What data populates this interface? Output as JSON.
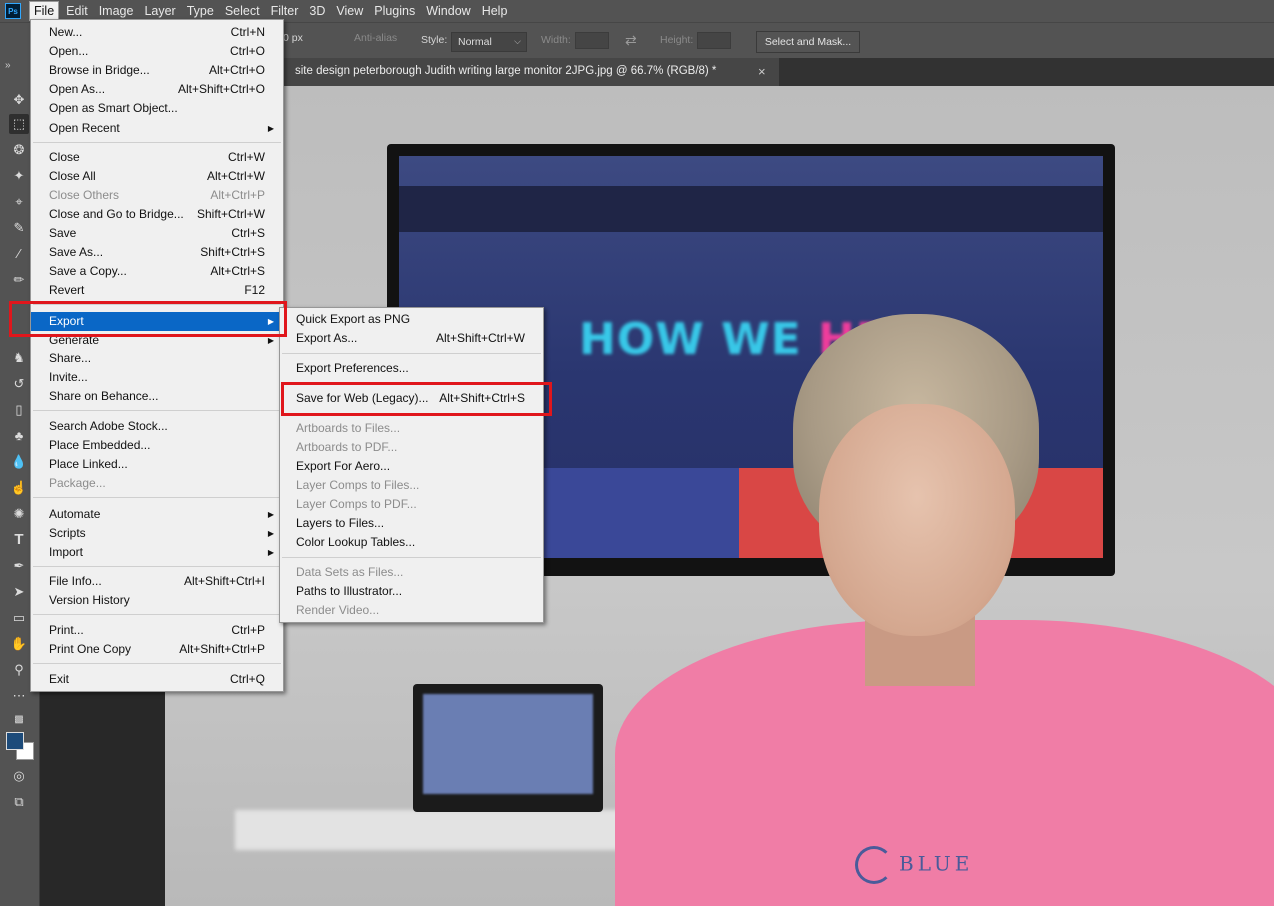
{
  "app": {
    "logo_text": "Ps"
  },
  "menubar": {
    "items": [
      "File",
      "Edit",
      "Image",
      "Layer",
      "Type",
      "Select",
      "Filter",
      "3D",
      "View",
      "Plugins",
      "Window",
      "Help"
    ],
    "active": "File"
  },
  "options_bar": {
    "feather_value": "0 px",
    "anti_alias_label": "Anti-alias",
    "style_label": "Style:",
    "style_value": "Normal",
    "width_label": "Width:",
    "height_label": "Height:",
    "select_mask_label": "Select and Mask..."
  },
  "document_tab": {
    "title": "site design peterborough Judith writing large monitor 2JPG.jpg @ 66.7% (RGB/8) *",
    "close_glyph": "×"
  },
  "photo": {
    "tv_headline_part1": "HOW WE ",
    "tv_headline_part2": "HEL",
    "shirt_text": "BLUE"
  },
  "colors": {
    "accent_highlight": "#0a67c6",
    "annotation_box": "#e0161c",
    "foreground_swatch": "#1d4b7a",
    "background_swatch": "#ffffff"
  },
  "file_menu": {
    "items": [
      {
        "label": "New...",
        "shortcut": "Ctrl+N"
      },
      {
        "label": "Open...",
        "shortcut": "Ctrl+O"
      },
      {
        "label": "Browse in Bridge...",
        "shortcut": "Alt+Ctrl+O"
      },
      {
        "label": "Open As...",
        "shortcut": "Alt+Shift+Ctrl+O"
      },
      {
        "label": "Open as Smart Object...",
        "shortcut": ""
      },
      {
        "label": "Open Recent",
        "shortcut": ""
      },
      {
        "label": "Close",
        "shortcut": "Ctrl+W"
      },
      {
        "label": "Close All",
        "shortcut": "Alt+Ctrl+W"
      },
      {
        "label": "Close Others",
        "shortcut": "Alt+Ctrl+P"
      },
      {
        "label": "Close and Go to Bridge...",
        "shortcut": "Shift+Ctrl+W"
      },
      {
        "label": "Save",
        "shortcut": "Ctrl+S"
      },
      {
        "label": "Save As...",
        "shortcut": "Shift+Ctrl+S"
      },
      {
        "label": "Save a Copy...",
        "shortcut": "Alt+Ctrl+S"
      },
      {
        "label": "Revert",
        "shortcut": "F12"
      },
      {
        "label": "Export",
        "shortcut": ""
      },
      {
        "label": "Generate",
        "shortcut": ""
      },
      {
        "label": "Share...",
        "shortcut": ""
      },
      {
        "label": "Invite...",
        "shortcut": ""
      },
      {
        "label": "Share on Behance...",
        "shortcut": ""
      },
      {
        "label": "Search Adobe Stock...",
        "shortcut": ""
      },
      {
        "label": "Place Embedded...",
        "shortcut": ""
      },
      {
        "label": "Place Linked...",
        "shortcut": ""
      },
      {
        "label": "Package...",
        "shortcut": ""
      },
      {
        "label": "Automate",
        "shortcut": ""
      },
      {
        "label": "Scripts",
        "shortcut": ""
      },
      {
        "label": "Import",
        "shortcut": ""
      },
      {
        "label": "File Info...",
        "shortcut": "Alt+Shift+Ctrl+I"
      },
      {
        "label": "Version History",
        "shortcut": ""
      },
      {
        "label": "Print...",
        "shortcut": "Ctrl+P"
      },
      {
        "label": "Print One Copy",
        "shortcut": "Alt+Shift+Ctrl+P"
      },
      {
        "label": "Exit",
        "shortcut": "Ctrl+Q"
      }
    ]
  },
  "export_menu": {
    "items": [
      {
        "label": "Quick Export as PNG",
        "shortcut": ""
      },
      {
        "label": "Export As...",
        "shortcut": "Alt+Shift+Ctrl+W"
      },
      {
        "label": "Export Preferences...",
        "shortcut": ""
      },
      {
        "label": "Save for Web (Legacy)...",
        "shortcut": "Alt+Shift+Ctrl+S"
      },
      {
        "label": "Artboards to Files...",
        "shortcut": ""
      },
      {
        "label": "Artboards to PDF...",
        "shortcut": ""
      },
      {
        "label": "Export For Aero...",
        "shortcut": ""
      },
      {
        "label": "Layer Comps to Files...",
        "shortcut": ""
      },
      {
        "label": "Layer Comps to PDF...",
        "shortcut": ""
      },
      {
        "label": "Layers to Files...",
        "shortcut": ""
      },
      {
        "label": "Color Lookup Tables...",
        "shortcut": ""
      },
      {
        "label": "Data Sets as Files...",
        "shortcut": ""
      },
      {
        "label": "Paths to Illustrator...",
        "shortcut": ""
      },
      {
        "label": "Render Video...",
        "shortcut": ""
      }
    ]
  }
}
